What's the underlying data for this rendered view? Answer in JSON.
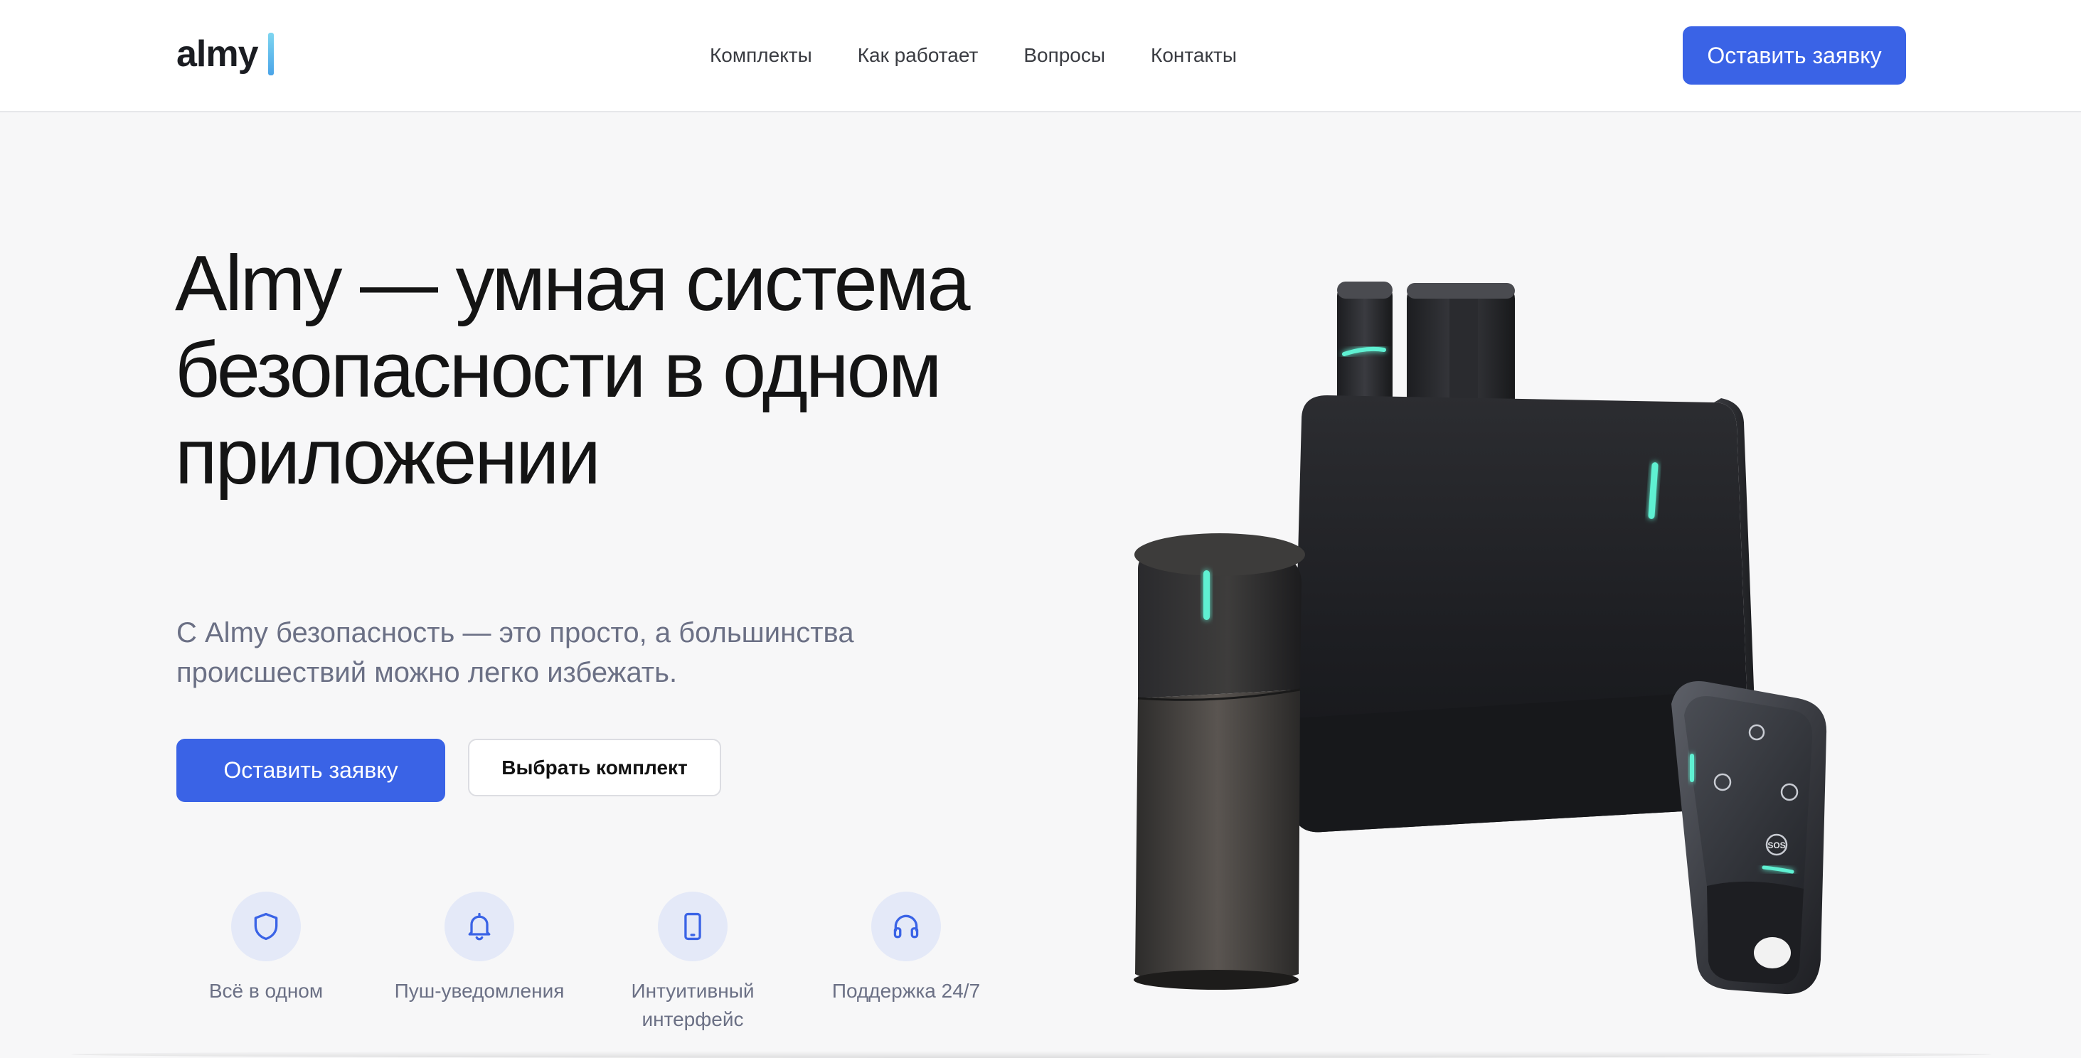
{
  "header": {
    "logo": "almy",
    "nav": [
      {
        "label": "Комплекты"
      },
      {
        "label": "Как работает"
      },
      {
        "label": "Вопросы"
      },
      {
        "label": "Контакты"
      }
    ],
    "cta_label": "Оставить заявку"
  },
  "hero": {
    "title": "Almy — умная система безопасности в одном приложении",
    "subtitle": "С Almy безопасность — это просто, а большинства происшествий можно легко избежать.",
    "primary_button": "Оставить заявку",
    "secondary_button": "Выбрать комплект"
  },
  "features": [
    {
      "icon": "shield-icon",
      "label": "Всё в одном"
    },
    {
      "icon": "bell-icon",
      "label": "Пуш-уведомления"
    },
    {
      "icon": "tablet-icon",
      "label": "Интуитивный интерфейс"
    },
    {
      "icon": "headphones-icon",
      "label": "Поддержка 24/7"
    }
  ],
  "product": {
    "keyfob_button_label": "SOS"
  },
  "colors": {
    "accent": "#3a63e6",
    "icon_bg": "#e4e9f8",
    "led": "#5ff0d2",
    "text_muted": "#6b7085"
  }
}
